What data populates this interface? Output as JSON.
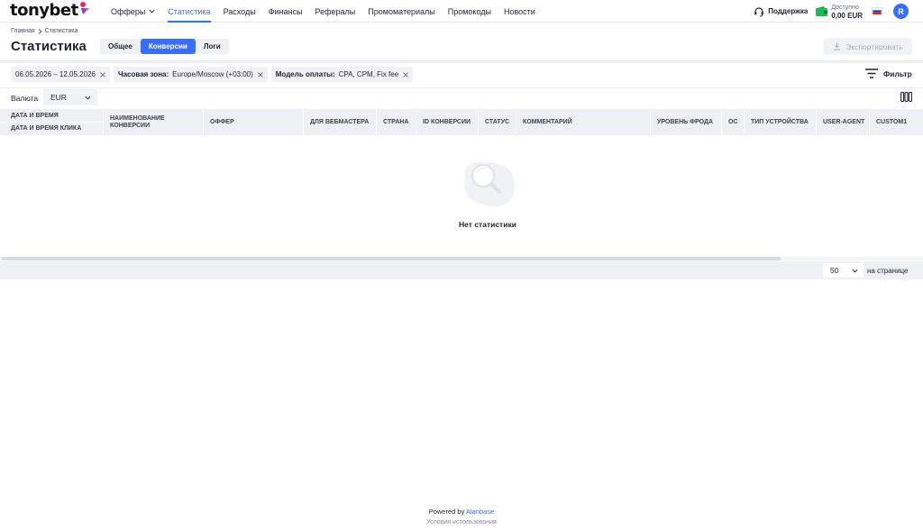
{
  "brand": {
    "logo_text": "tonybet",
    "accent": "#3b6ef6"
  },
  "nav": {
    "items": [
      {
        "label": "Офферы",
        "has_dropdown": true
      },
      {
        "label": "Статистика",
        "active": true
      },
      {
        "label": "Расходы"
      },
      {
        "label": "Финансы"
      },
      {
        "label": "Рефералы"
      },
      {
        "label": "Промоматериалы"
      },
      {
        "label": "Промокоды"
      },
      {
        "label": "Новости"
      }
    ]
  },
  "header_right": {
    "support_label": "Поддержка",
    "balance_label": "Доступно",
    "balance_value": "0,00 EUR",
    "avatar_initial": "R"
  },
  "breadcrumb": {
    "home": "Главная",
    "current": "Статистика"
  },
  "page": {
    "title": "Статистика",
    "tabs": [
      {
        "label": "Общее"
      },
      {
        "label": "Конверсии",
        "active": true
      },
      {
        "label": "Логи"
      }
    ],
    "export_label": "Экспортировать"
  },
  "filters": {
    "chips": [
      {
        "key": "",
        "value": "06.05.2026 – 12.05.2026"
      },
      {
        "key": "Часовая зона:",
        "value": "Europe/Moscow (+03:00)"
      },
      {
        "key": "Модель оплаты:",
        "value": "CPA, CPM, Fix fee"
      }
    ],
    "filter_label": "Фильтр"
  },
  "currency": {
    "label": "Валюта",
    "value": "EUR"
  },
  "table": {
    "columns": [
      {
        "label": "Дата и время",
        "sublabel": "Дата и время клика",
        "stacked": true
      },
      {
        "label": "Наименование конверсии"
      },
      {
        "label": "Оффер"
      },
      {
        "label": "Для вебмастера"
      },
      {
        "label": "Страна"
      },
      {
        "label": "ID конверсии"
      },
      {
        "label": "Статус"
      },
      {
        "label": "Комментарий"
      },
      {
        "label": "Уровень фрода"
      },
      {
        "label": "ОС"
      },
      {
        "label": "Тип устройства"
      },
      {
        "label": "User-Agent"
      },
      {
        "label": "Custom1"
      }
    ],
    "empty_text": "Нет статистики"
  },
  "pagination": {
    "per_page_value": "50",
    "per_page_label": "на странице"
  },
  "footer": {
    "powered_prefix": "Powered by",
    "powered_brand": "Alanbase",
    "terms": "Условия использования"
  }
}
